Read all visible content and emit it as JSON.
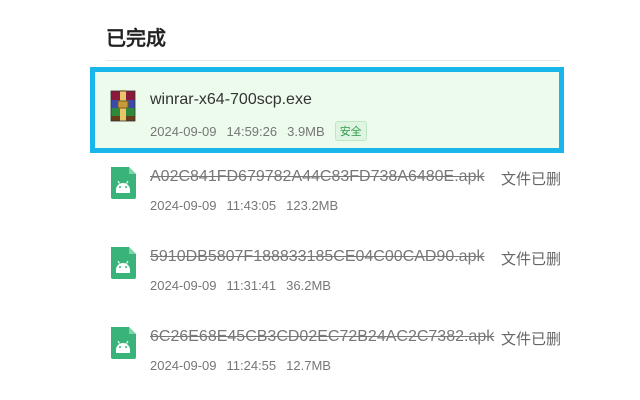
{
  "section": {
    "title": "已完成"
  },
  "items": [
    {
      "name": "winrar-x64-700scp.exe",
      "date": "2024-09-09",
      "time": "14:59:26",
      "size": "3.9MB",
      "badge": "安全",
      "status": "",
      "icon": "winrar-archive-icon",
      "deleted": false
    },
    {
      "name": "A02C841FD679782A44C83FD738A6480E.apk",
      "date": "2024-09-09",
      "time": "11:43:05",
      "size": "123.2MB",
      "badge": "",
      "status": "文件已删除",
      "icon": "android-apk-icon",
      "deleted": true
    },
    {
      "name": "5910DB5807F188833185CE04C00CAD90.apk",
      "date": "2024-09-09",
      "time": "11:31:41",
      "size": "36.2MB",
      "badge": "",
      "status": "文件已删除",
      "icon": "android-apk-icon",
      "deleted": true
    },
    {
      "name": "6C26E68E45CB3CD02EC72B24AC2C7382.apk",
      "date": "2024-09-09",
      "time": "11:24:55",
      "size": "12.7MB",
      "badge": "",
      "status": "文件已删除",
      "icon": "android-apk-icon",
      "deleted": true
    }
  ],
  "colors": {
    "accent": "#1ab5ea",
    "selected_bg": "#ecfbec",
    "android_green": "#3ddc84",
    "safe_green": "#2f9b4a"
  }
}
